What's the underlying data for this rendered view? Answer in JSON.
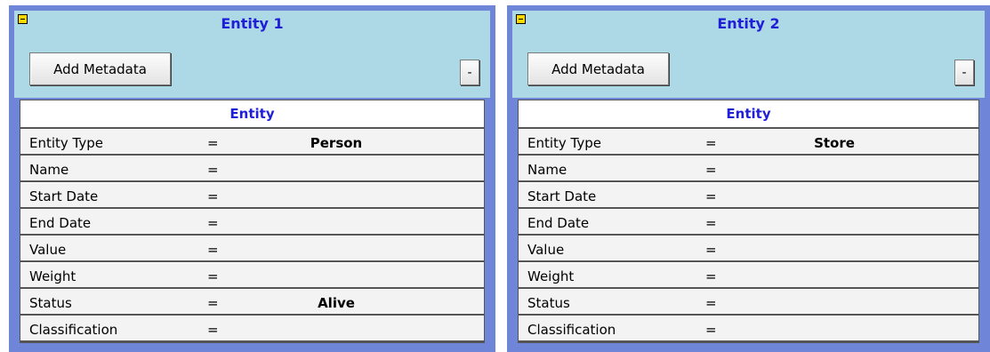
{
  "panels": [
    {
      "title": "Entity 1",
      "add_metadata_label": "Add Metadata",
      "minus_label": "-",
      "table_header": "Entity",
      "rows": [
        {
          "label": "Entity Type",
          "eq": "=",
          "value": "Person"
        },
        {
          "label": "Name",
          "eq": "=",
          "value": ""
        },
        {
          "label": "Start Date",
          "eq": "=",
          "value": ""
        },
        {
          "label": "End Date",
          "eq": "=",
          "value": ""
        },
        {
          "label": "Value",
          "eq": "=",
          "value": ""
        },
        {
          "label": "Weight",
          "eq": "=",
          "value": ""
        },
        {
          "label": "Status",
          "eq": "=",
          "value": "Alive"
        },
        {
          "label": "Classification",
          "eq": "=",
          "value": ""
        }
      ]
    },
    {
      "title": "Entity 2",
      "add_metadata_label": "Add Metadata",
      "minus_label": "-",
      "table_header": "Entity",
      "rows": [
        {
          "label": "Entity Type",
          "eq": "=",
          "value": "Store"
        },
        {
          "label": "Name",
          "eq": "=",
          "value": ""
        },
        {
          "label": "Start Date",
          "eq": "=",
          "value": ""
        },
        {
          "label": "End Date",
          "eq": "=",
          "value": ""
        },
        {
          "label": "Value",
          "eq": "=",
          "value": ""
        },
        {
          "label": "Weight",
          "eq": "=",
          "value": ""
        },
        {
          "label": "Status",
          "eq": "=",
          "value": ""
        },
        {
          "label": "Classification",
          "eq": "=",
          "value": ""
        }
      ]
    }
  ],
  "colors": {
    "panel_border": "#6f86d8",
    "header_bg": "#add8e6",
    "title_text": "#1f1fd6",
    "collapse_icon": "#ffd800"
  },
  "icons": {
    "collapse": "minus-square-icon"
  }
}
